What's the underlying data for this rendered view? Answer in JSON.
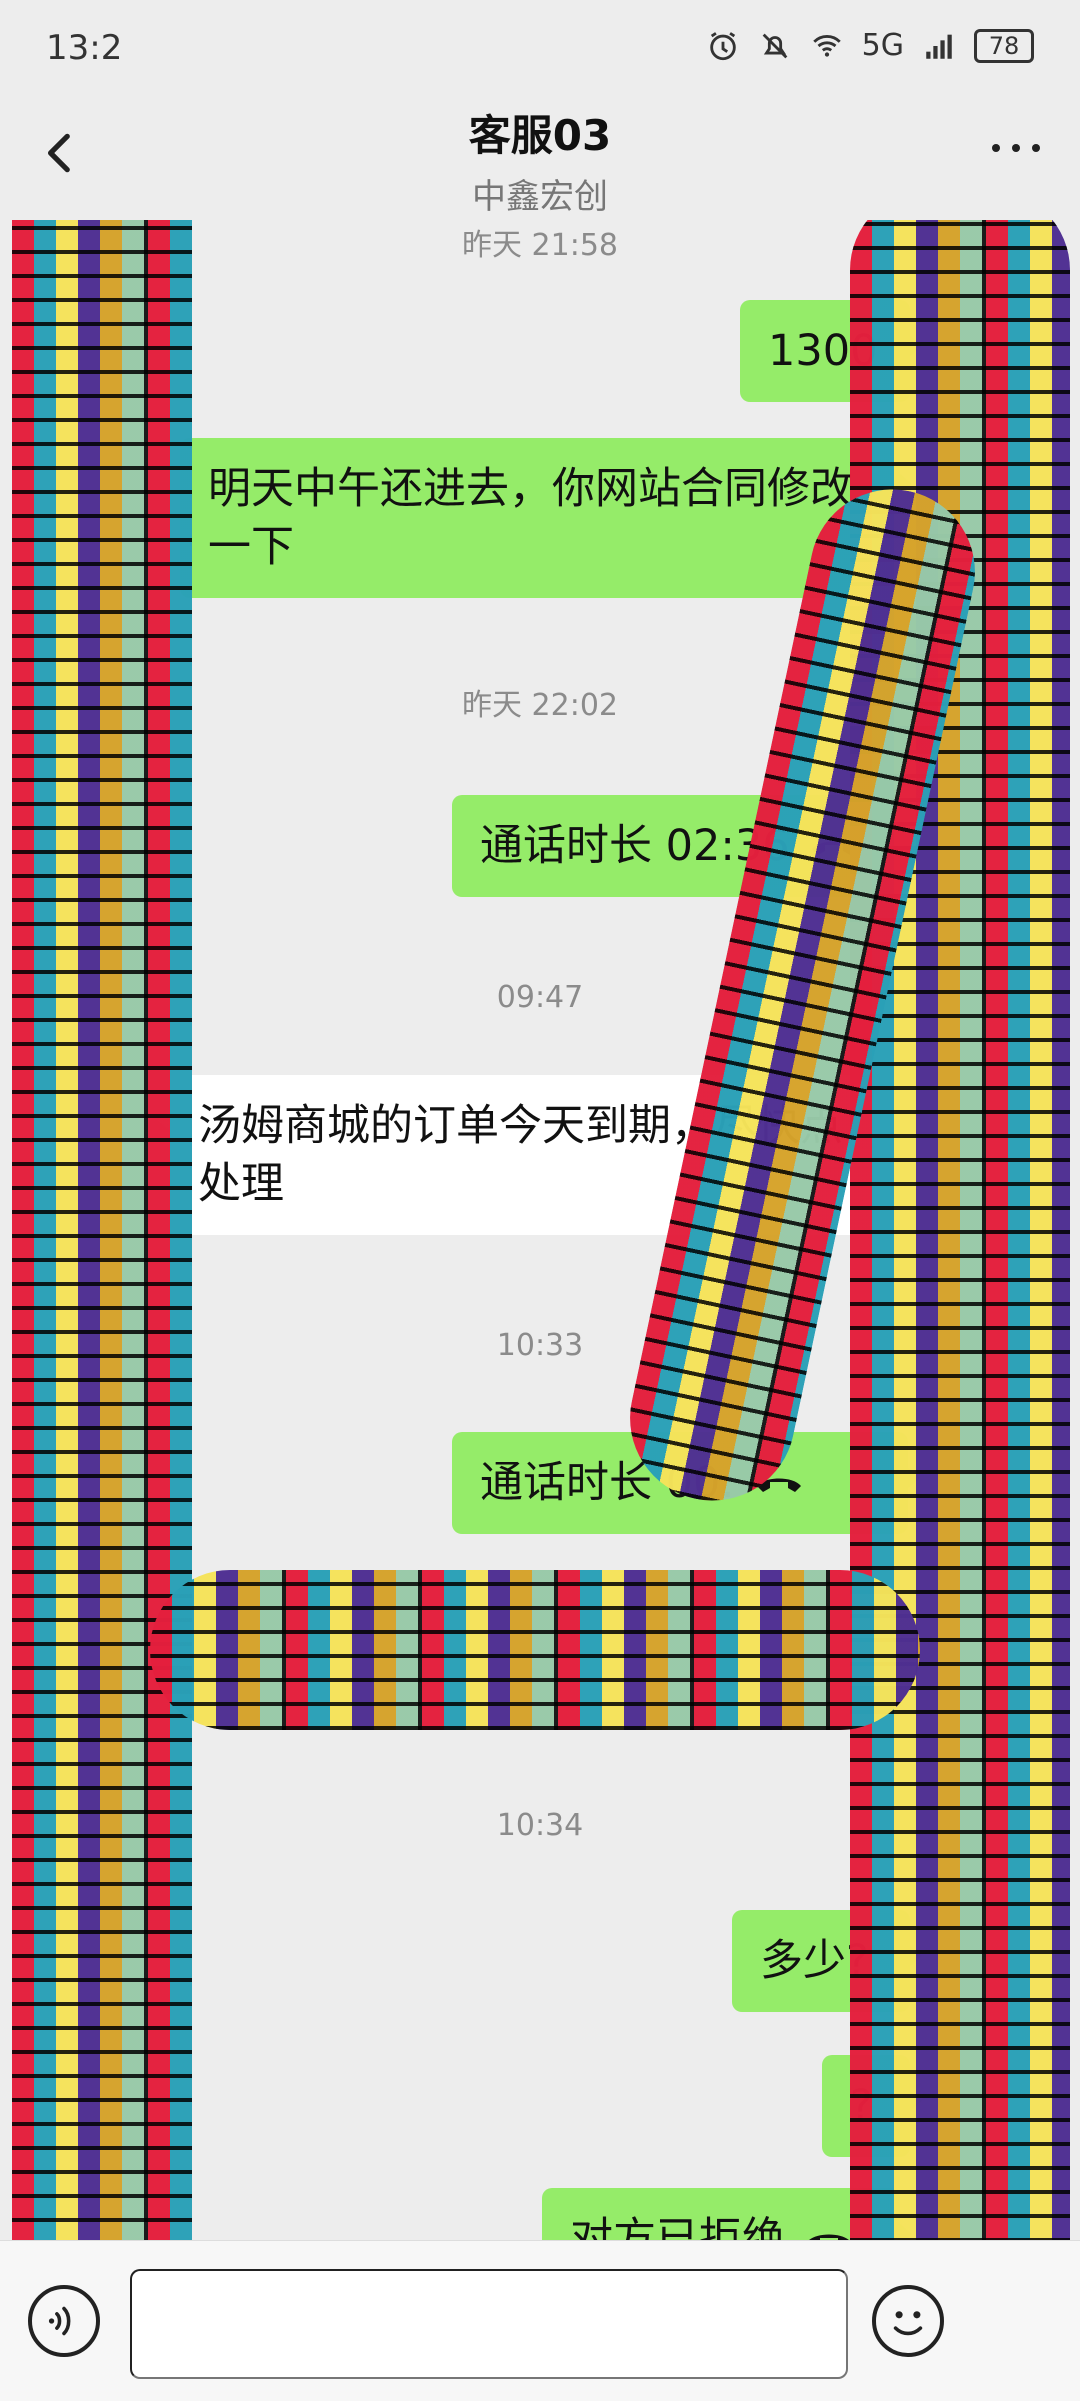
{
  "status_bar": {
    "time": "13:2",
    "battery": "78",
    "network_label": "5G"
  },
  "nav": {
    "title": "客服03",
    "subtitle": "中鑫宏创",
    "more_label": "···"
  },
  "messages": [
    {
      "kind": "timestamp",
      "text": "昨天 21:58"
    },
    {
      "kind": "outgoing",
      "text": "1300"
    },
    {
      "kind": "outgoing",
      "text": "明天中午还进去，你网站合同修改一下"
    },
    {
      "kind": "timestamp",
      "text": "昨天 22:02"
    },
    {
      "kind": "outgoing_call",
      "text": "通话时长 02:36"
    },
    {
      "kind": "timestamp",
      "text": "09:47"
    },
    {
      "kind": "incoming",
      "text": "汤姆商城的订单今天到期，尽快点处理"
    },
    {
      "kind": "timestamp",
      "text": "10:33"
    },
    {
      "kind": "outgoing_call",
      "text": "通话时长 00:"
    },
    {
      "kind": "timestamp",
      "text": "10:34"
    },
    {
      "kind": "outgoing",
      "text": "多少?"
    },
    {
      "kind": "outgoing",
      "text": "?"
    },
    {
      "kind": "outgoing_call",
      "text": "对方已拒绝"
    }
  ],
  "input": {
    "placeholder": ""
  },
  "colors": {
    "background": "#ededed",
    "outgoing_bubble": "#95ec69",
    "incoming_bubble": "#ffffff",
    "timestamp": "#8b8b8b"
  }
}
